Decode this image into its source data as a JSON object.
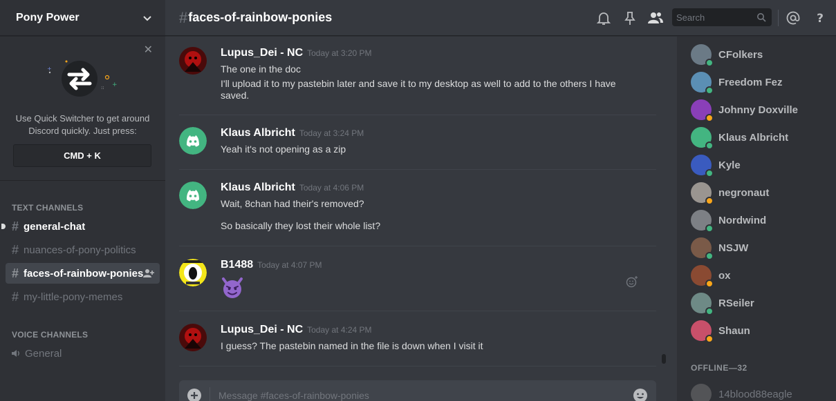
{
  "colors": {
    "online": "#43b581",
    "idle": "#faa61a",
    "discord_green": "#43b581",
    "accent": "#7289da"
  },
  "server": {
    "name": "Pony Power"
  },
  "quick_switcher": {
    "description": "Use Quick Switcher to get around Discord quickly. Just press:",
    "shortcut": "CMD + K",
    "close_icon": "close-icon"
  },
  "categories": {
    "text": "TEXT CHANNELS",
    "voice": "VOICE CHANNELS"
  },
  "text_channels": [
    {
      "name": "general-chat",
      "state": "unread"
    },
    {
      "name": "nuances-of-pony-politics",
      "state": "normal"
    },
    {
      "name": "faces-of-rainbow-ponies",
      "state": "selected"
    },
    {
      "name": "my-little-pony-memes",
      "state": "normal"
    }
  ],
  "voice_channels": [
    {
      "name": "General"
    }
  ],
  "header": {
    "hash": "#",
    "channel": "faces-of-rainbow-ponies",
    "search_placeholder": "Search",
    "icons": [
      "bell-icon",
      "pin-icon",
      "members-icon",
      "search-icon",
      "at-icon",
      "help-icon"
    ]
  },
  "messages": [
    {
      "author": "Lupus_Dei - NC",
      "time": "Today at 3:20 PM",
      "avatar": "red-avatar",
      "lines": [
        "The one in the doc",
        "I'll upload it to my pastebin later and save it to my desktop as well to add to the others I have saved."
      ]
    },
    {
      "author": "Klaus Albricht",
      "time": "Today at 3:24 PM",
      "avatar": "discord-avatar",
      "lines": [
        "Yeah it's not opening as a zip"
      ]
    },
    {
      "author": "Klaus Albricht",
      "time": "Today at 4:06 PM",
      "avatar": "discord-avatar",
      "lines": [
        "Wait, 8chan had their's removed?",
        "So basically they lost their whole list?"
      ]
    },
    {
      "author": "B1488",
      "time": "Today at 4:07 PM",
      "avatar": "yellow-avatar",
      "emoji": "smiling-imp-emoji"
    },
    {
      "author": "Lupus_Dei - NC",
      "time": "Today at 4:24 PM",
      "avatar": "red-avatar",
      "lines": [
        "I guess? The pastebin named in the file is down when I visit it"
      ]
    }
  ],
  "composer": {
    "placeholder": "Message #faces-of-rainbow-ponies"
  },
  "members": {
    "online": [
      {
        "name": "CFolkers",
        "status": "online",
        "color": "#6b7a86"
      },
      {
        "name": "Freedom Fez",
        "status": "online",
        "color": "#5b8fb4"
      },
      {
        "name": "Johnny Doxville",
        "status": "idle",
        "color": "#8a3fb8"
      },
      {
        "name": "Klaus Albricht",
        "status": "online",
        "color": "#43b581"
      },
      {
        "name": "Kyle",
        "status": "online",
        "color": "#3a5bbf"
      },
      {
        "name": "negronaut",
        "status": "idle",
        "color": "#9a9590"
      },
      {
        "name": "Nordwind",
        "status": "online",
        "color": "#7d8085"
      },
      {
        "name": "NSJW",
        "status": "online",
        "color": "#7a5a48"
      },
      {
        "name": "ox",
        "status": "idle",
        "color": "#8a4a32"
      },
      {
        "name": "RSeiler",
        "status": "online",
        "color": "#6e8a86"
      },
      {
        "name": "Shaun",
        "status": "idle",
        "color": "#c8506a"
      }
    ],
    "offline_label": "OFFLINE—32",
    "offline": [
      {
        "name": "14blood88eagle",
        "color": "#8a8a8a"
      }
    ]
  }
}
